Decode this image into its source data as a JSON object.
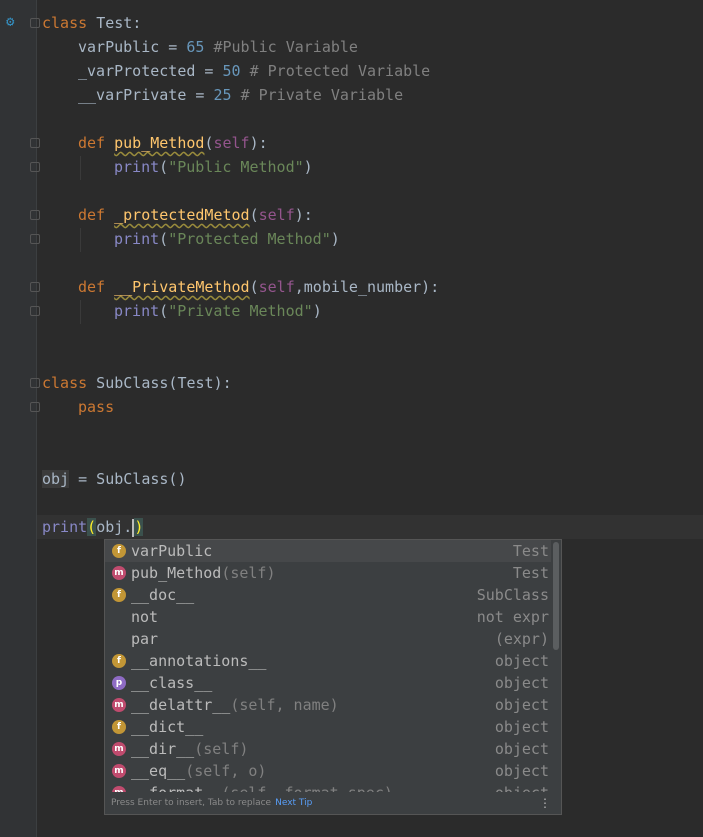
{
  "editor": {
    "lines": {
      "l1": [
        "class",
        " ",
        "Test",
        ":"
      ],
      "l2": [
        "varPublic",
        " = ",
        "65",
        " ",
        "#Public Variable"
      ],
      "l3": [
        "_varProtected",
        " = ",
        "50",
        " ",
        "# Protected Variable"
      ],
      "l4": [
        "__varPrivate",
        " = ",
        "25",
        " ",
        "# Private Variable"
      ],
      "l6": [
        "def",
        " ",
        "pub_Method",
        "(",
        "self",
        "):"
      ],
      "l7": [
        "print",
        "(",
        "\"Public Method\"",
        ")"
      ],
      "l9": [
        "def",
        " ",
        "_protectedMetod",
        "(",
        "self",
        "):"
      ],
      "l10": [
        "print",
        "(",
        "\"Protected Method\"",
        ")"
      ],
      "l12": [
        "def",
        " ",
        "__PrivateMethod",
        "(",
        "self",
        ",mobile_number):"
      ],
      "l13": [
        "print",
        "(",
        "\"Private Method\"",
        ")"
      ],
      "l16": [
        "class",
        " SubClass(Test):"
      ],
      "l17": [
        "pass"
      ],
      "l20": [
        "obj",
        " = SubClass()"
      ],
      "l22": [
        "print",
        "(",
        "obj.",
        ")"
      ]
    }
  },
  "completion": {
    "items": [
      {
        "icon": "f",
        "name": "varPublic",
        "sig": "",
        "type": "Test"
      },
      {
        "icon": "m",
        "name": "pub_Method",
        "sig": "(self)",
        "type": "Test"
      },
      {
        "icon": "f",
        "name": "__doc__",
        "sig": "",
        "type": "SubClass"
      },
      {
        "icon": "",
        "name": "not",
        "sig": "",
        "type": "not expr"
      },
      {
        "icon": "",
        "name": "par",
        "sig": "",
        "type": "(expr)"
      },
      {
        "icon": "f",
        "name": "__annotations__",
        "sig": "",
        "type": "object"
      },
      {
        "icon": "p",
        "name": "__class__",
        "sig": "",
        "type": "object"
      },
      {
        "icon": "m",
        "name": "__delattr__",
        "sig": "(self, name)",
        "type": "object"
      },
      {
        "icon": "f",
        "name": "__dict__",
        "sig": "",
        "type": "object"
      },
      {
        "icon": "m",
        "name": "__dir__",
        "sig": "(self)",
        "type": "object"
      },
      {
        "icon": "m",
        "name": "__eq__",
        "sig": "(self, o)",
        "type": "object"
      },
      {
        "icon": "m",
        "name": "__format__",
        "sig": "(self, format_spec)",
        "type": "object"
      }
    ],
    "footer_hint": "Press Enter to insert, Tab to replace",
    "footer_tip": "Next Tip",
    "menu_glyph": "⋮"
  },
  "icons": {
    "gutter": "override-gear-icon"
  }
}
